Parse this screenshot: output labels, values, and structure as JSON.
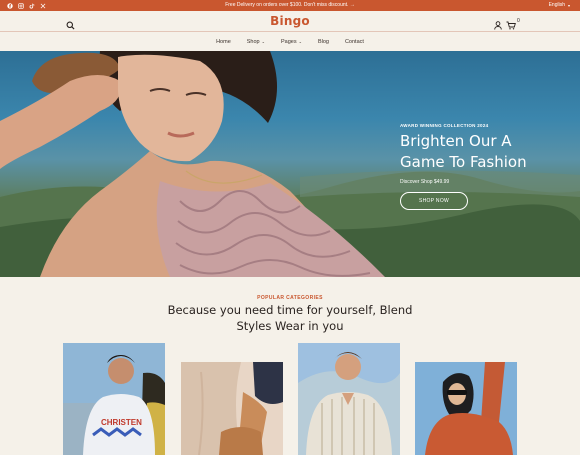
{
  "topbar": {
    "promo": "Free Delivery on orders over $100. Don't miss discount. →",
    "language": "English",
    "socials": [
      "facebook-icon",
      "instagram-icon",
      "tiktok-icon",
      "x-icon"
    ]
  },
  "header": {
    "logo": "Bingo",
    "cart_count": "0"
  },
  "nav": {
    "items": [
      {
        "label": "Home",
        "has_menu": false
      },
      {
        "label": "Shop",
        "has_menu": true
      },
      {
        "label": "Pages",
        "has_menu": true
      },
      {
        "label": "Blog",
        "has_menu": false
      },
      {
        "label": "Contact",
        "has_menu": false
      }
    ]
  },
  "hero": {
    "kicker": "AWARD WINNING COLLECTION 2024",
    "title_line1": "Brighten Our A",
    "title_line2": "Game To Fashion",
    "price_text": "Discover Shop $49.99",
    "cta": "SHOP NOW"
  },
  "categories": {
    "kicker": "POPULAR CATEGORIES",
    "title_line1": "Because you need time for yourself, Blend",
    "title_line2": "Styles Wear in you"
  },
  "colors": {
    "accent": "#c9572f",
    "background": "#f5f1e9",
    "text": "#2a2320"
  }
}
